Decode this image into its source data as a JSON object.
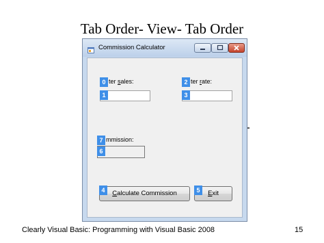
{
  "slide": {
    "title": "Tab Order-  View- Tab Order",
    "footer": "Clearly Visual Basic: Programming with Visual Basic 2008",
    "page_number": "15"
  },
  "window": {
    "title": "Commission Calculator",
    "icon": "app-form-icon",
    "controls": [
      "minimize-icon",
      "maximize-icon",
      "close-icon"
    ]
  },
  "form": {
    "sales_label_rest": "ter ",
    "sales_label_access": "s",
    "sales_label_tail": "ales:",
    "rate_label_rest": "ter ",
    "rate_label_access": "r",
    "rate_label_tail": "ate:",
    "commission_label": "mmission:",
    "calculate_access": "C",
    "calculate_rest": "alculate Commission",
    "exit_access": "E",
    "exit_rest": "xit"
  },
  "tab_indexes": {
    "sales_label": "0",
    "sales_textbox": "1",
    "rate_label": "2",
    "rate_textbox": "3",
    "calculate_button": "4",
    "exit_button": "5",
    "commission_output": "6",
    "commission_label": "7"
  },
  "colors": {
    "tab_badge": "#3f8fe8",
    "window_frame": "#c7d9ee",
    "close_button": "#c5432c"
  }
}
